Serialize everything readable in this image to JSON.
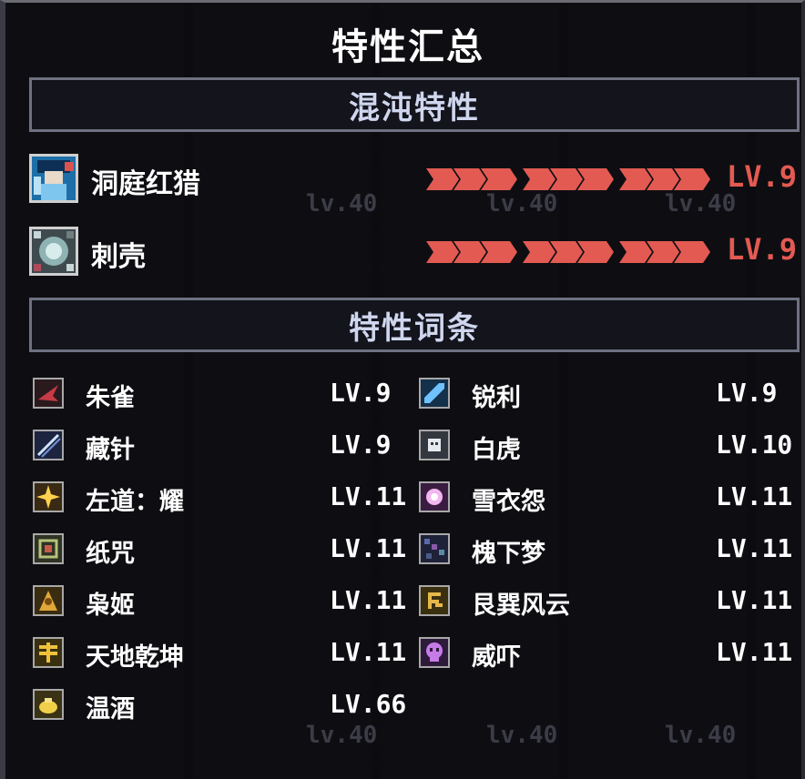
{
  "panel_title": "特性汇总",
  "chaos_section": {
    "header": "混沌特性",
    "items": [
      {
        "name": "洞庭红猎",
        "level": "LV.9",
        "icon": "hunter-portrait-icon"
      },
      {
        "name": "刺壳",
        "level": "LV.9",
        "icon": "spiked-shell-icon"
      }
    ]
  },
  "traits_section": {
    "header": "特性词条",
    "left": [
      {
        "name": "朱雀",
        "level": "LV.9",
        "icon": "vermilion-bird-icon"
      },
      {
        "name": "藏针",
        "level": "LV.9",
        "icon": "hidden-needle-icon"
      },
      {
        "name": "左道：耀",
        "level": "LV.11",
        "icon": "radiant-star-icon"
      },
      {
        "name": "纸咒",
        "level": "LV.11",
        "icon": "paper-curse-icon"
      },
      {
        "name": "枭姬",
        "level": "LV.11",
        "icon": "owl-maiden-icon"
      },
      {
        "name": "天地乾坤",
        "level": "LV.11",
        "icon": "heaven-earth-icon"
      },
      {
        "name": "温酒",
        "level": "LV.66",
        "icon": "warm-wine-icon"
      }
    ],
    "right": [
      {
        "name": "锐利",
        "level": "LV.9",
        "icon": "sharp-blade-icon"
      },
      {
        "name": "白虎",
        "level": "LV.10",
        "icon": "white-tiger-icon"
      },
      {
        "name": "雪衣怨",
        "level": "LV.11",
        "icon": "snow-robe-icon"
      },
      {
        "name": "槐下梦",
        "level": "LV.11",
        "icon": "locust-dream-icon"
      },
      {
        "name": "艮巽风云",
        "level": "LV.11",
        "icon": "wind-cloud-icon"
      },
      {
        "name": "威吓",
        "level": "LV.11",
        "icon": "skull-intimidate-icon"
      }
    ]
  },
  "background_ghost_labels": [
    "lv.40",
    "lv.40",
    "lv.40",
    "lv.40",
    "lv.40",
    "lv.40",
    "lv.40",
    "lv.40",
    "lv.40"
  ],
  "colors": {
    "chaos_bar": "#e35a52",
    "header_text": "#cfd6ee",
    "border": "#6e7180"
  }
}
